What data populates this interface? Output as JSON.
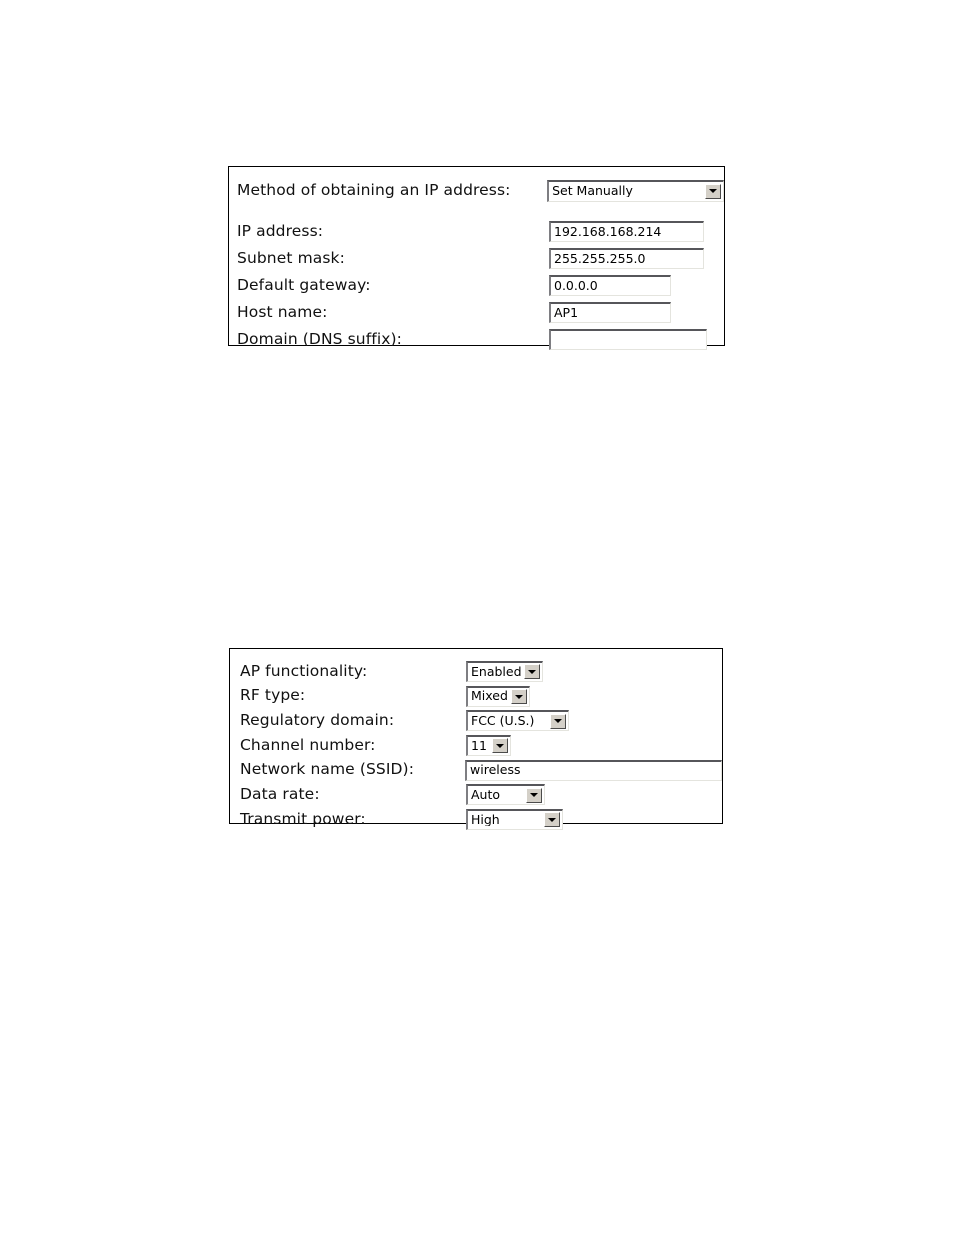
{
  "page": {
    "background_color": "#ffffff",
    "panel_border_color": "#000000"
  },
  "ip_panel": {
    "name": "ip-address-configuration-panel",
    "rows": [
      {
        "label": "Method of obtaining an IP address:",
        "control": "dropdown",
        "value": "Set Manually",
        "field_name": "ip-method"
      },
      {
        "label": "IP address:",
        "control": "textbox",
        "value": "192.168.168.214",
        "placeholder": "",
        "field_name": "ip-address"
      },
      {
        "label": "Subnet mask:",
        "control": "textbox",
        "value": "255.255.255.0",
        "placeholder": "",
        "field_name": "subnet-mask"
      },
      {
        "label": "Default gateway:",
        "control": "textbox",
        "value": "0.0.0.0",
        "placeholder": "",
        "field_name": "default-gateway"
      },
      {
        "label": "Host name:",
        "control": "textbox",
        "value": "AP1",
        "placeholder": "",
        "field_name": "host-name"
      },
      {
        "label": "Domain (DNS suffix):",
        "control": "textbox",
        "value": "",
        "placeholder": "",
        "field_name": "domain-dns-suffix"
      }
    ]
  },
  "wireless_panel": {
    "name": "wireless-configuration-panel",
    "rows": [
      {
        "label": "AP functionality:",
        "control": "dropdown",
        "value": "Enabled",
        "field_name": "ap-functionality"
      },
      {
        "label": "RF type:",
        "control": "dropdown",
        "value": "Mixed",
        "field_name": "rf-type"
      },
      {
        "label": "Regulatory domain:",
        "control": "dropdown",
        "value": "FCC (U.S.)",
        "field_name": "regulatory-domain"
      },
      {
        "label": "Channel number:",
        "control": "dropdown",
        "value": "11",
        "field_name": "channel-number"
      },
      {
        "label": "Network name (SSID):",
        "control": "textbox",
        "value": "wireless",
        "placeholder": "",
        "field_name": "network-name-ssid"
      },
      {
        "label": "Data rate:",
        "control": "dropdown",
        "value": "Auto",
        "field_name": "data-rate"
      },
      {
        "label": "Transmit power:",
        "control": "dropdown",
        "value": "High",
        "field_name": "transmit-power"
      }
    ]
  },
  "icons": {
    "dropdown_arrow": "chevron-down-icon"
  }
}
